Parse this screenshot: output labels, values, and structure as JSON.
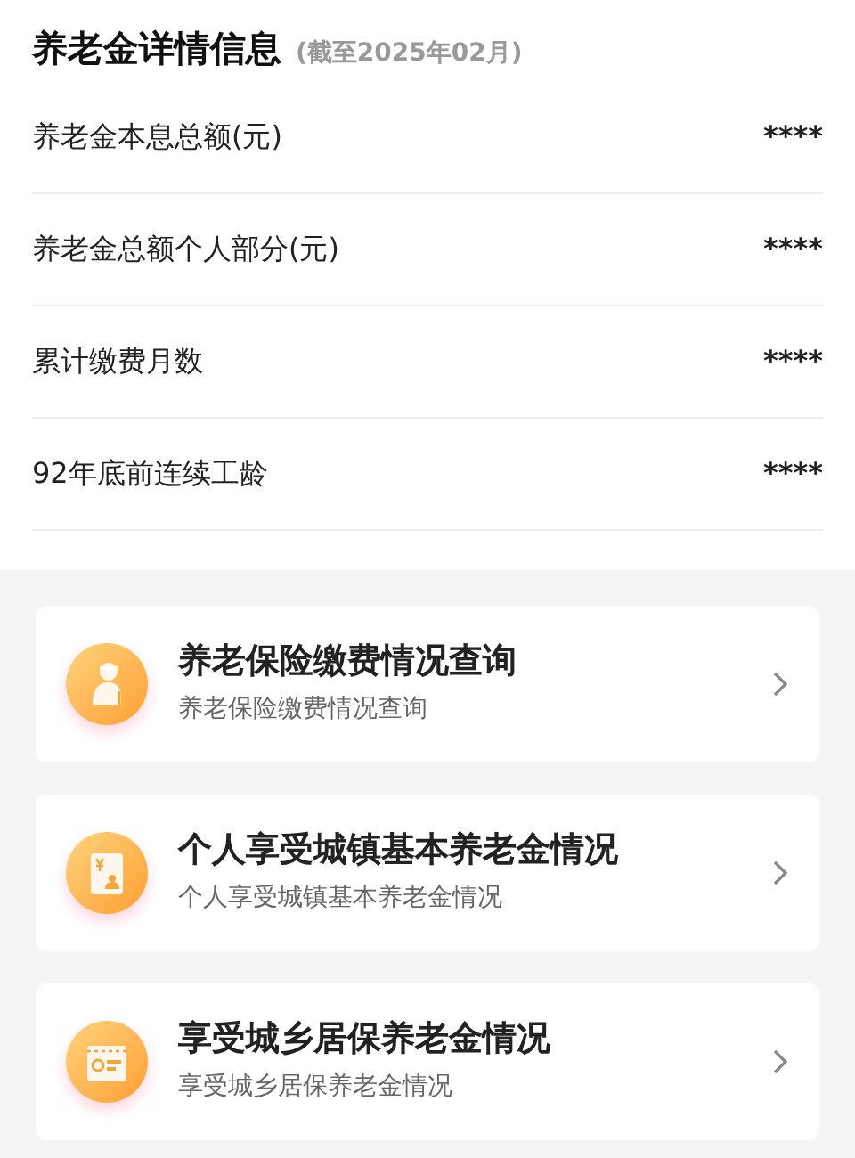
{
  "header": {
    "title": "养老金详情信息",
    "subtitle": "(截至2025年02月)"
  },
  "rows": [
    {
      "label": "养老金本息总额(元)",
      "value": "****"
    },
    {
      "label": "养老金总额个人部分(元)",
      "value": "****"
    },
    {
      "label": "累计缴费月数",
      "value": "****"
    },
    {
      "label": "92年底前连续工龄",
      "value": "****"
    }
  ],
  "cards": [
    {
      "kind": "elder",
      "title": "养老保险缴费情况查询",
      "subtitle": "养老保险缴费情况查询"
    },
    {
      "kind": "passbook",
      "title": "个人享受城镇基本养老金情况",
      "subtitle": "个人享受城镇基本养老金情况"
    },
    {
      "kind": "card",
      "title": "享受城乡居保养老金情况",
      "subtitle": "享受城乡居保养老金情况"
    }
  ]
}
